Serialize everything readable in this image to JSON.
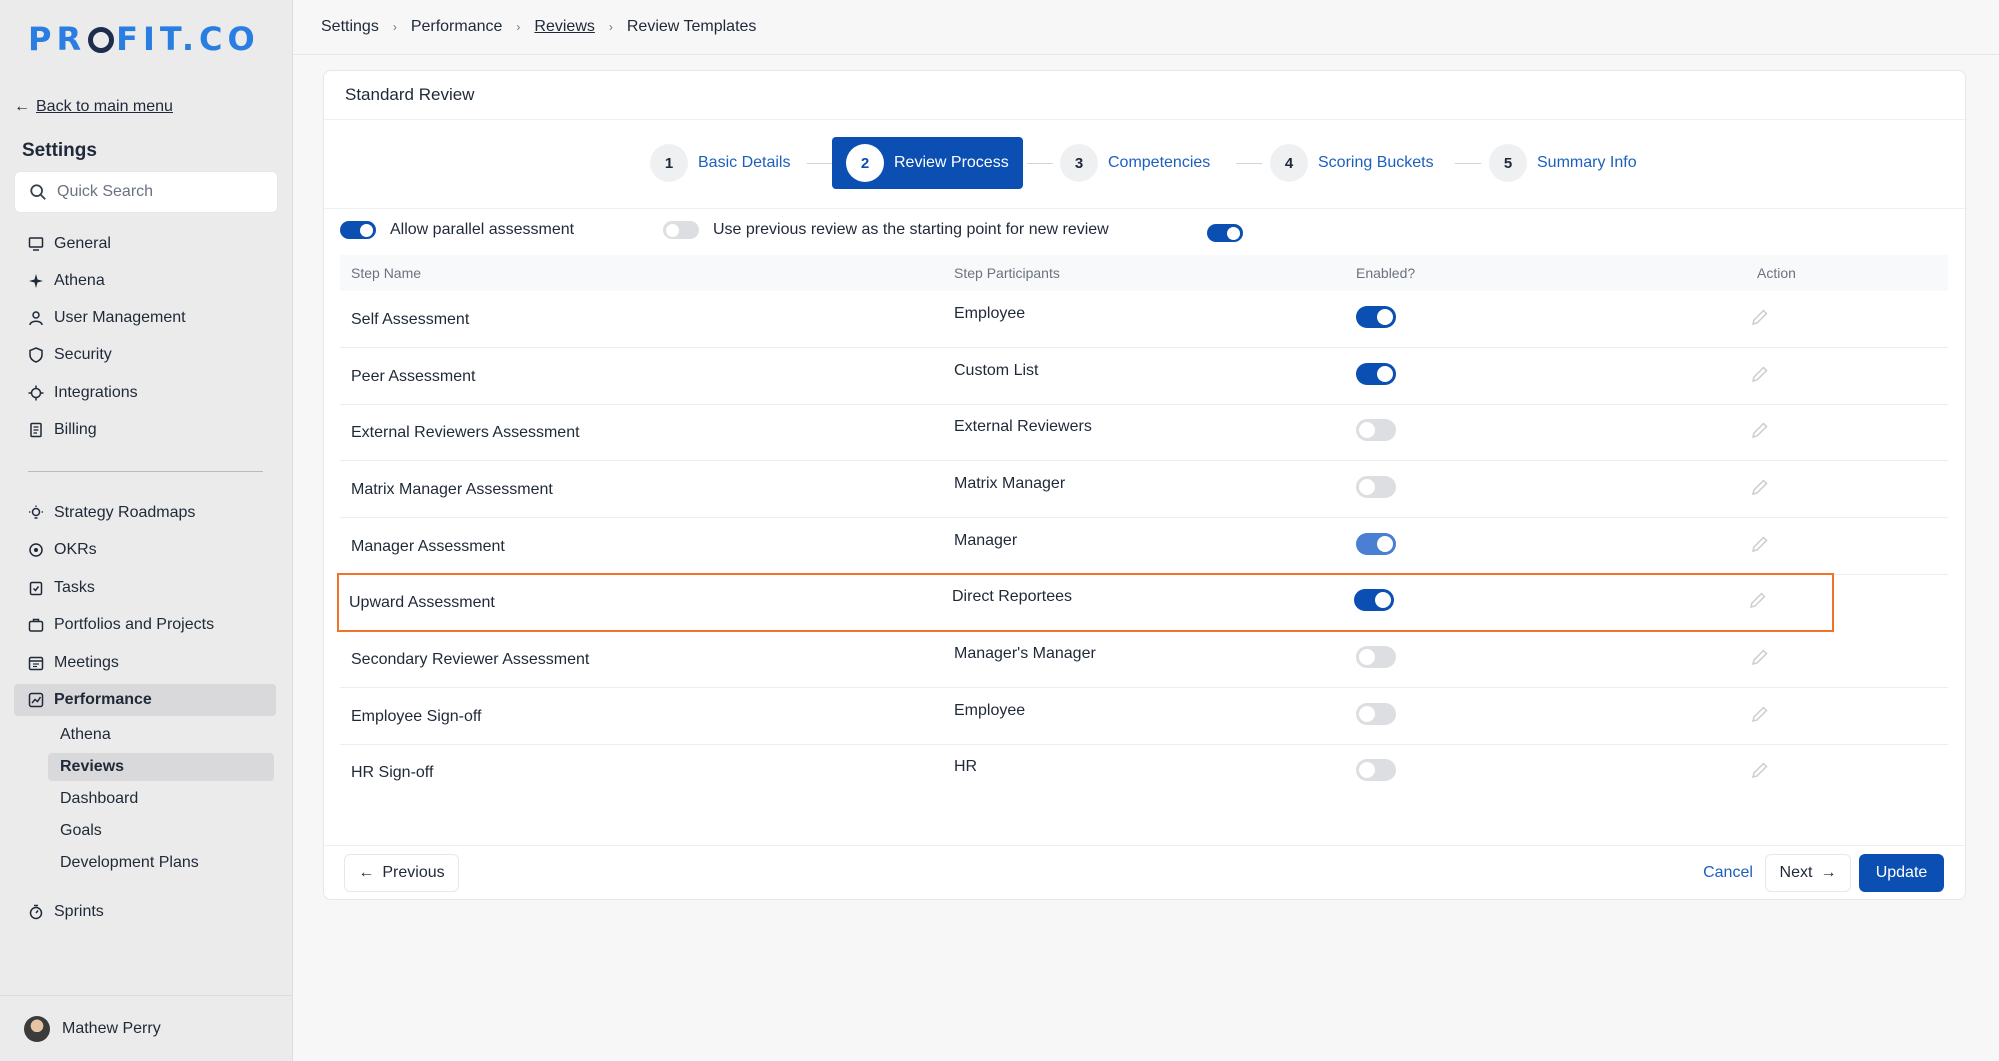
{
  "brand": {
    "logo_left": "PR",
    "logo_right": "FIT.CO"
  },
  "sidebar": {
    "back_label": "Back to main menu",
    "title": "Settings",
    "search_placeholder": "Quick Search",
    "items_top": [
      {
        "label": "General",
        "icon": "monitor-icon"
      },
      {
        "label": "Athena",
        "icon": "sparkle-icon"
      },
      {
        "label": "User Management",
        "icon": "user-icon"
      },
      {
        "label": "Security",
        "icon": "shield-icon"
      },
      {
        "label": "Integrations",
        "icon": "plug-icon"
      },
      {
        "label": "Billing",
        "icon": "receipt-icon"
      }
    ],
    "items_bottom": [
      {
        "label": "Strategy Roadmaps",
        "icon": "lightbulb-icon"
      },
      {
        "label": "OKRs",
        "icon": "target-icon"
      },
      {
        "label": "Tasks",
        "icon": "clipboard-icon"
      },
      {
        "label": "Portfolios and Projects",
        "icon": "briefcase-icon"
      },
      {
        "label": "Meetings",
        "icon": "calendar-icon"
      },
      {
        "label": "Performance",
        "icon": "chart-icon"
      }
    ],
    "performance_sub": [
      "Athena",
      "Reviews",
      "Dashboard",
      "Goals",
      "Development Plans"
    ],
    "sprints_label": "Sprints",
    "user_name": "Mathew Perry"
  },
  "breadcrumb": [
    "Settings",
    "Performance",
    "Reviews",
    "Review Templates"
  ],
  "card": {
    "title": "Standard Review"
  },
  "steps": [
    {
      "num": "1",
      "label": "Basic Details"
    },
    {
      "num": "2",
      "label": "Review Process"
    },
    {
      "num": "3",
      "label": "Competencies"
    },
    {
      "num": "4",
      "label": "Scoring Buckets"
    },
    {
      "num": "5",
      "label": "Summary Info"
    }
  ],
  "options": {
    "parallel_label": "Allow parallel assessment",
    "previous_label": "Use previous review as the starting point for new review"
  },
  "table": {
    "headers": [
      "Step Name",
      "Step Participants",
      "Enabled?",
      "Action"
    ],
    "rows": [
      {
        "name": "Self Assessment",
        "participants": "Employee",
        "enabled": true
      },
      {
        "name": "Peer Assessment",
        "participants": "Custom List",
        "enabled": true
      },
      {
        "name": "External Reviewers Assessment",
        "participants": "External Reviewers",
        "enabled": false
      },
      {
        "name": "Matrix Manager Assessment",
        "participants": "Matrix Manager",
        "enabled": false
      },
      {
        "name": "Manager Assessment",
        "participants": "Manager",
        "enabled": true
      },
      {
        "name": "Upward Assessment",
        "participants": "Direct Reportees",
        "enabled": true
      },
      {
        "name": "Secondary Reviewer Assessment",
        "participants": "Manager's Manager",
        "enabled": false
      },
      {
        "name": "Employee Sign-off",
        "participants": "Employee",
        "enabled": false
      },
      {
        "name": "HR Sign-off",
        "participants": "HR",
        "enabled": false
      }
    ]
  },
  "footer": {
    "previous": "Previous",
    "cancel": "Cancel",
    "next": "Next",
    "update": "Update"
  },
  "colors": {
    "primary": "#0b4fb3",
    "link": "#1d5fbf",
    "highlight": "#f07428",
    "logo": "#2a7de1"
  }
}
